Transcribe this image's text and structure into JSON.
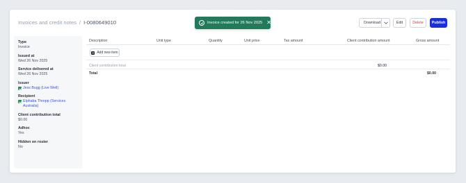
{
  "breadcrumb": {
    "parent": "Invoices and credit notes",
    "separator": "/",
    "current": "I-0080649010"
  },
  "toast": {
    "message": "Invoice created for 26 Nov 2025",
    "close": "✕",
    "color": "#237a5a"
  },
  "actions": {
    "download": "Download",
    "edit": "Edit",
    "delete": "Delete",
    "publish": "Publish",
    "publish_color": "#1a2fd6",
    "delete_color": "#d23b3b"
  },
  "sidebar": {
    "fields": [
      {
        "label": "Type",
        "value": "Invoice"
      },
      {
        "label": "Issued at",
        "value": "Wed 26 Nov 2025"
      },
      {
        "label": "Service delivered at",
        "value": "Wed 26 Nov 2025"
      },
      {
        "label": "Issuer",
        "value": "Jess Bugg (Live Well)"
      },
      {
        "label": "Recipient",
        "value": "Elphaba Thropp (Services Australia)"
      },
      {
        "label": "Client contribution total",
        "value": "$0.00"
      },
      {
        "label": "Adhoc",
        "value": "Yes"
      },
      {
        "label": "Hidden on roster",
        "value": "No"
      }
    ]
  },
  "table": {
    "headers": {
      "description": "Description",
      "unit_type": "Unit type",
      "quantity": "Quantity",
      "unit_price": "Unit price",
      "tax_amount": "Tax amount",
      "client_contribution_amount": "Client contribution amount",
      "gross_amount": "Gross amount"
    },
    "add_item": "Add new item",
    "client_contribution_row": {
      "label": "Client contribution total",
      "amount": "$0.00"
    },
    "total_row": {
      "label": "Total",
      "amount": "$0.00"
    }
  }
}
